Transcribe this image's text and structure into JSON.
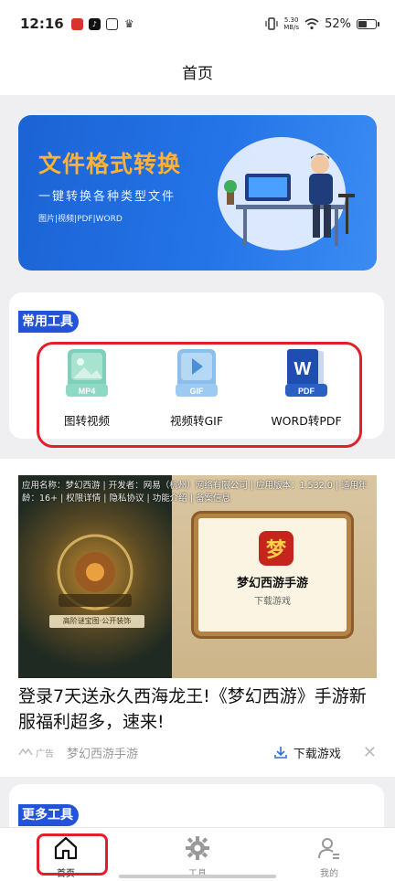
{
  "status_bar": {
    "time": "12:16",
    "net_speed_value": "5.30",
    "net_speed_unit": "MB/s",
    "battery": "52%",
    "battery_level": 0.52
  },
  "header": {
    "title": "首页"
  },
  "banner": {
    "title": "文件格式转换",
    "subtitle": "一键转换各种类型文件",
    "tags": "图片|视频|PDF|WORD"
  },
  "common_tools": {
    "heading": "常用工具",
    "items": [
      {
        "label": "图转视频",
        "badge": "MP4",
        "icon": "image-to-video-icon"
      },
      {
        "label": "视频转GIF",
        "badge": "GIF",
        "icon": "video-to-gif-icon"
      },
      {
        "label": "WORD转PDF",
        "badge": "PDF",
        "icon": "word-to-pdf-icon"
      }
    ]
  },
  "ad": {
    "meta": "应用名称：梦幻西游 | 开发者：网易（杭州）网络有限公司 | 应用版本：1.532.0 | 适用年龄：16+ | 权限详情 | 隐私协议 | 功能介绍 | 备案信息",
    "game_icon_char": "梦",
    "game_name": "梦幻西游手游",
    "board_download": "下载游戏",
    "scene_caption": "高阶谜宝图·公开装饰",
    "headline": "登录7天送永久西海龙王!《梦幻西游》手游新服福利超多，速来!",
    "ad_tag": "广告",
    "advertiser": "梦幻西游手游",
    "download_label": "下载游戏",
    "close": "✕"
  },
  "more_tools": {
    "heading": "更多工具"
  },
  "tabbar": {
    "items": [
      {
        "label": "首页",
        "icon": "home-icon",
        "active": true
      },
      {
        "label": "工具",
        "icon": "gear-icon",
        "active": false
      },
      {
        "label": "我的",
        "icon": "person-icon",
        "active": false
      }
    ]
  },
  "colors": {
    "accent": "#2253d8",
    "banner_blue": "#2474e8",
    "banner_title": "#ffb236",
    "highlight_red": "#e3202a"
  }
}
